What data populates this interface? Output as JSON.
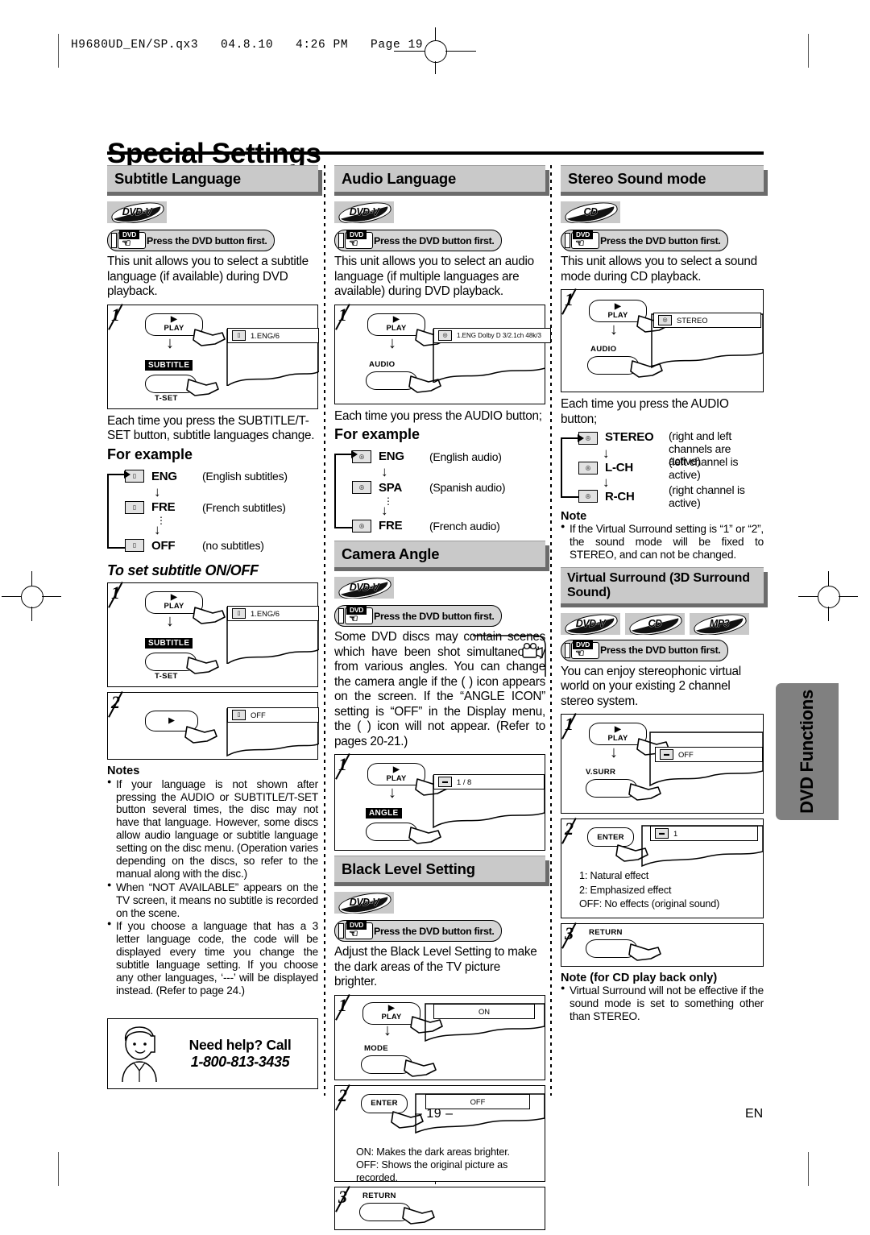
{
  "slug": "H9680UD_EN/SP.qx3   04.8.10   4:26 PM   Page 19",
  "page_title": "Special Settings",
  "side_tab": "DVD Functions",
  "footer": {
    "page_number": "– 19 –",
    "language": "EN"
  },
  "press_dvd": "Press the DVD button first.",
  "badges": {
    "dvdv": "DVD-V",
    "cd": "CD",
    "mp3": "MP3"
  },
  "keys": {
    "play": "PLAY",
    "subtitle": "SUBTITLE",
    "tset": "T-SET",
    "audio": "AUDIO",
    "angle": "ANGLE",
    "mode": "MODE",
    "enter": "ENTER",
    "return": "RETURN",
    "vsurr": "V.SURR"
  },
  "subtitle_language": {
    "heading": "Subtitle Language",
    "intro": "This unit allows you to select a subtitle language (if available) during DVD playback.",
    "step1_osd": "1.ENG/6",
    "after_step": "Each time you press the SUBTITLE/T-SET button, subtitle languages change.",
    "for_example": "For example",
    "flow": [
      {
        "code": "ENG",
        "desc": "(English subtitles)"
      },
      {
        "code": "FRE",
        "desc": "(French subtitles)"
      },
      {
        "code": "OFF",
        "desc": "(no subtitles)"
      }
    ],
    "onoff_heading": "To set subtitle ON/OFF",
    "onoff_step1_osd": "1.ENG/6",
    "onoff_step2_osd": "OFF",
    "notes_heading": "Notes",
    "notes": [
      "If your language is not shown after pressing the AUDIO or SUBTITLE/T-SET button several times, the disc may not have that language. However, some discs allow audio language or subtitle language setting on the disc menu. (Operation varies depending on the discs, so refer to the manual along with the disc.)",
      "When “NOT AVAILABLE” appears on the TV screen, it means no subtitle is recorded on the scene.",
      "If you choose a language that has a 3 letter language code, the code will be displayed every time you change the subtitle language setting. If you choose any other languages, ‘---’ will be displayed instead. (Refer to page 24.)"
    ]
  },
  "help": {
    "line1": "Need help? Call",
    "line2": "1-800-813-3435"
  },
  "audio_language": {
    "heading": "Audio Language",
    "intro": "This unit allows you to select an audio language (if multiple languages are available) during DVD playback.",
    "step1_osd": "1.ENG  Dolby D  3/2.1ch  48k/3",
    "after_step": "Each time you press the AUDIO button;",
    "for_example": "For example",
    "flow": [
      {
        "code": "ENG",
        "desc": "(English audio)"
      },
      {
        "code": "SPA",
        "desc": "(Spanish audio)"
      },
      {
        "code": "FRE",
        "desc": "(French audio)"
      }
    ]
  },
  "camera_angle": {
    "heading": "Camera Angle",
    "intro": "Some DVD discs may contain scenes which have been shot simultaneously from various angles. You can change the camera angle if the (     ) icon appears on the screen. If the “ANGLE ICON” setting is “OFF” in the Display menu, the (     ) icon will not appear. (Refer to pages 20-21.)",
    "step1_osd": "1 / 8"
  },
  "black_level": {
    "heading": "Black Level Setting",
    "intro": "Adjust the Black Level Setting to make the dark areas of the TV picture brighter.",
    "step1_osd": "ON",
    "step2_osd": "OFF",
    "caption_on": "ON: Makes the dark areas brighter.",
    "caption_off": "OFF: Shows the original picture as recorded."
  },
  "stereo_sound": {
    "heading": "Stereo Sound mode",
    "intro": "This unit allows you to select a sound mode during CD playback.",
    "step1_osd": "STEREO",
    "after_step": "Each time you press the AUDIO button;",
    "flow": [
      {
        "code": "STEREO",
        "desc": "(right and left channels are active)"
      },
      {
        "code": "L-CH",
        "desc": "(left channel is active)"
      },
      {
        "code": "R-CH",
        "desc": "(right channel is active)"
      }
    ],
    "note_heading": "Note",
    "note": "If the Virtual Surround setting is “1” or “2”, the sound mode will be fixed to STEREO, and can not be changed."
  },
  "virtual_surround": {
    "heading": "Virtual Surround (3D Surround Sound)",
    "intro": "You can enjoy stereophonic virtual world on your existing 2 channel stereo system.",
    "step1_osd": "OFF",
    "step2_osd": "1",
    "captions": [
      "1: Natural effect",
      "2: Emphasized effect",
      "OFF: No effects (original sound)"
    ],
    "note_heading": "Note (for CD play back only)",
    "note": "Virtual Surround will not be effective if the sound mode is set to something other than STEREO."
  }
}
